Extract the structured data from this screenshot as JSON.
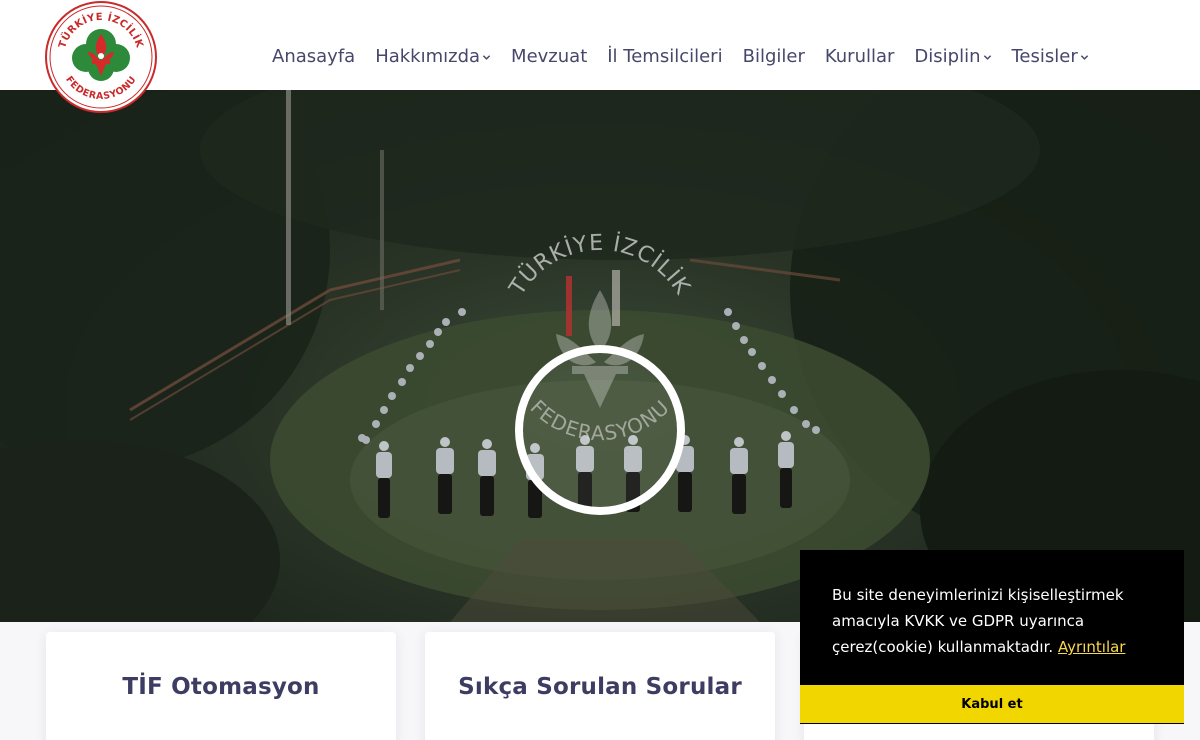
{
  "brand": {
    "logo_text_top": "TÜRKİYE İZCİLİK",
    "logo_text_bottom": "FEDERASYONU",
    "colors": {
      "red": "#d42a2a",
      "green": "#2d8a3a",
      "hero_dark": "#1c241b",
      "cookie_button": "#f1d600"
    }
  },
  "nav": {
    "items": [
      {
        "label": "Anasayfa",
        "has_dropdown": false
      },
      {
        "label": "Hakkımızda",
        "has_dropdown": true
      },
      {
        "label": "Mevzuat",
        "has_dropdown": false
      },
      {
        "label": "İl Temsilcileri",
        "has_dropdown": false
      },
      {
        "label": "Bilgiler",
        "has_dropdown": false
      },
      {
        "label": "Kurullar",
        "has_dropdown": false
      },
      {
        "label": "Disiplin",
        "has_dropdown": true
      },
      {
        "label": "Tesisler",
        "has_dropdown": true
      }
    ]
  },
  "hero": {
    "emblem_text_top": "TÜRKİYE İZCİLİK",
    "emblem_text_bottom": "FEDERASYONU",
    "play_icon": "play-circle-icon"
  },
  "cards": [
    {
      "title": "TİF Otomasyon"
    },
    {
      "title": "Sıkça Sorulan Sorular"
    },
    {
      "title": ""
    }
  ],
  "cookie": {
    "message": "Bu site deneyimlerinizi kişiselleştirmek amacıyla KVKK ve GDPR uyarınca çerez(cookie) kullanmaktadır.",
    "link_label": "Ayrıntılar",
    "accept_label": "Kabul et"
  }
}
